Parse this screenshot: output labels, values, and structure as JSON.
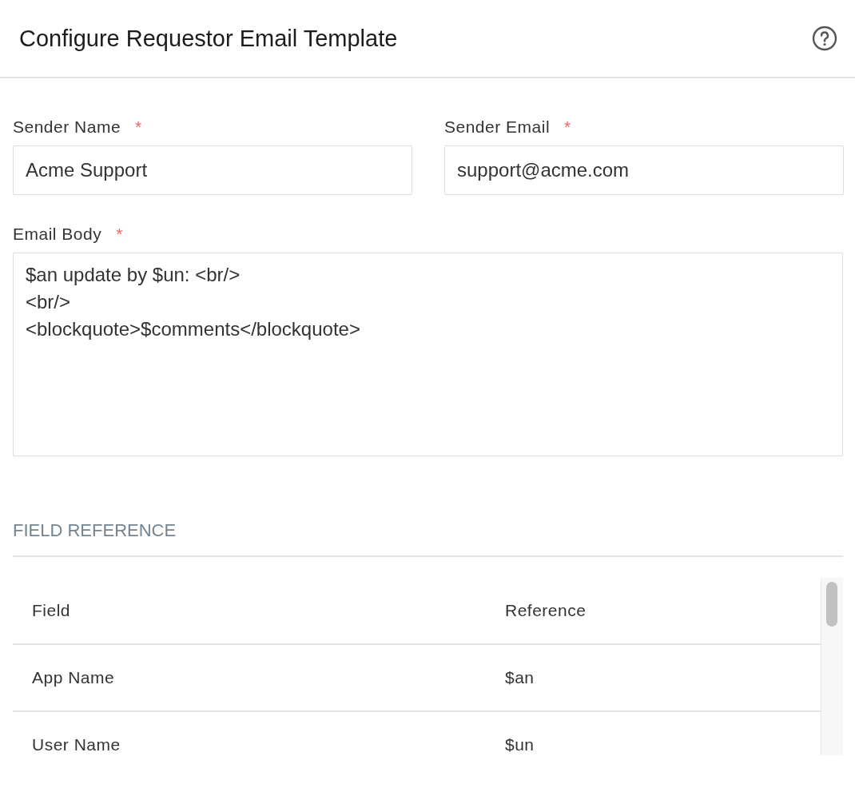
{
  "header": {
    "title": "Configure Requestor Email Template"
  },
  "fields": [
    {
      "label": "Sender Name",
      "required_mark": "*",
      "value": "Acme Support"
    },
    {
      "label": "Sender Email",
      "required_mark": "*",
      "value": "support@acme.com"
    }
  ],
  "body": {
    "label": "Email Body",
    "required_mark": "*",
    "value": "$an update by $un: <br/>\n<br/>\n<blockquote>$comments</blockquote>"
  },
  "field_reference": {
    "heading": "FIELD REFERENCE",
    "columns": [
      "Field",
      "Reference"
    ],
    "rows": [
      [
        "App Name",
        "$an"
      ],
      [
        "User Name",
        "$un"
      ]
    ]
  }
}
